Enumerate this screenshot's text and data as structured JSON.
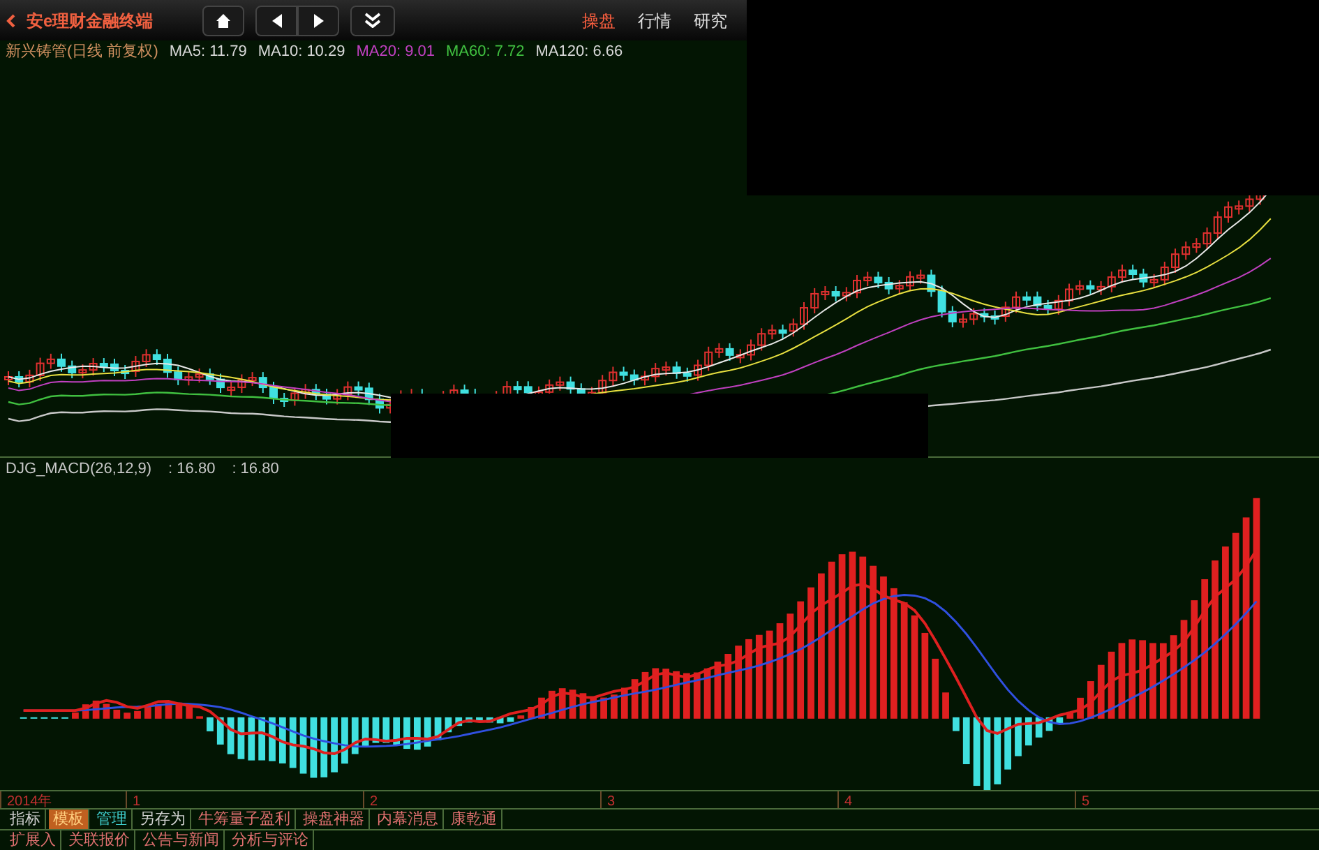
{
  "top_bar": {
    "logo": "安e理财金融终端",
    "tabs": [
      {
        "label": "操盘",
        "selected": true
      },
      {
        "label": "行情",
        "selected": false
      },
      {
        "label": "研究",
        "selected": false
      }
    ]
  },
  "price_panel": {
    "title": "新兴铸管(日线 前复权)",
    "indicators": [
      {
        "label": "MA5: 11.79",
        "color": "#d8d8d8"
      },
      {
        "label": "MA10: 10.29",
        "color": "#d8d8d8"
      },
      {
        "label": "MA20: 9.01",
        "color": "#c040c0"
      },
      {
        "label": "MA60: 7.72",
        "color": "#40c040"
      },
      {
        "label": "MA120: 6.66",
        "color": "#d8d8d8"
      }
    ]
  },
  "macd_panel": {
    "title": "DJG_MACD(26,12,9)",
    "readings": [
      ": 16.80",
      ": 16.80"
    ]
  },
  "time_axis": {
    "labels": [
      "2014年",
      "1",
      "2",
      "3",
      "4",
      "5"
    ]
  },
  "tool_tabs": [
    {
      "label": "指标",
      "kind": "plain"
    },
    {
      "label": "模板",
      "kind": "active"
    },
    {
      "label": "管理",
      "kind": "accent"
    },
    {
      "label": "另存为",
      "kind": "plain"
    },
    {
      "label": "牛筹量子盈利",
      "kind": "promo"
    },
    {
      "label": "操盘神器",
      "kind": "promo"
    },
    {
      "label": "内幕消息",
      "kind": "promo"
    },
    {
      "label": "康乾通",
      "kind": "promo"
    }
  ],
  "info_tabs": [
    "扩展入",
    "关联报价",
    "公告与新闻",
    "分析与评论"
  ]
}
